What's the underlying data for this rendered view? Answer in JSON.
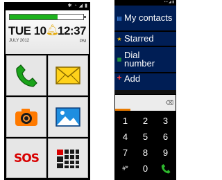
{
  "home": {
    "clock": {
      "date": "TUE 10",
      "time": "12:37",
      "month_year": "JULY 2012",
      "ampm": "PM",
      "battery_level": 0.65
    },
    "tiles": [
      {
        "icon": "phone-icon"
      },
      {
        "icon": "envelope-icon"
      },
      {
        "icon": "camera-icon"
      },
      {
        "icon": "gallery-icon"
      },
      {
        "label": "SOS"
      },
      {
        "icon": "apps-grid-icon"
      }
    ]
  },
  "contacts_menu": {
    "items": [
      {
        "label": "My contacts",
        "icon": "contacts-icon"
      },
      {
        "label": "Starred",
        "icon": "star-icon"
      },
      {
        "label": "Dial number",
        "icon": "dialpad-icon"
      },
      {
        "label": "Add",
        "icon": "add-contact-icon"
      }
    ]
  },
  "dialer": {
    "keys": [
      "1",
      "2",
      "3",
      "4",
      "5",
      "6",
      "7",
      "8",
      "9",
      "#*",
      "0"
    ]
  },
  "colors": {
    "battery_green": "#1db21d",
    "menu_blue": "#001e55",
    "sos_red": "#d80000",
    "dial_accent": "#e87a00",
    "call_green": "#2db82d"
  }
}
